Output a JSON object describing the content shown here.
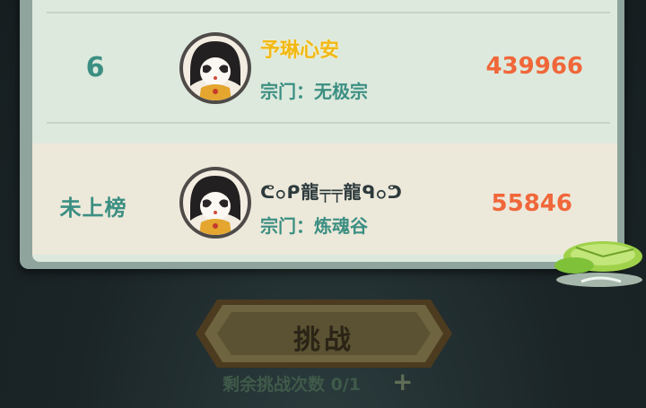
{
  "rows": [
    {
      "rank": "6",
      "name": "予琳心安",
      "sect": "宗门：无极宗",
      "score": "439966"
    }
  ],
  "player": {
    "rank": "未上榜",
    "name": "ᕦ၀ᑭ龍╤╤龍ᑫ၀ᕤ",
    "sect": "宗门：炼魂谷",
    "score": "55846"
  },
  "challenge": {
    "label": "挑战",
    "remaining": "剩余挑战次数 0/1"
  },
  "colors": {
    "rank": "#3b8f82",
    "score": "#f0673a",
    "name_highlight": "#f2b814"
  }
}
